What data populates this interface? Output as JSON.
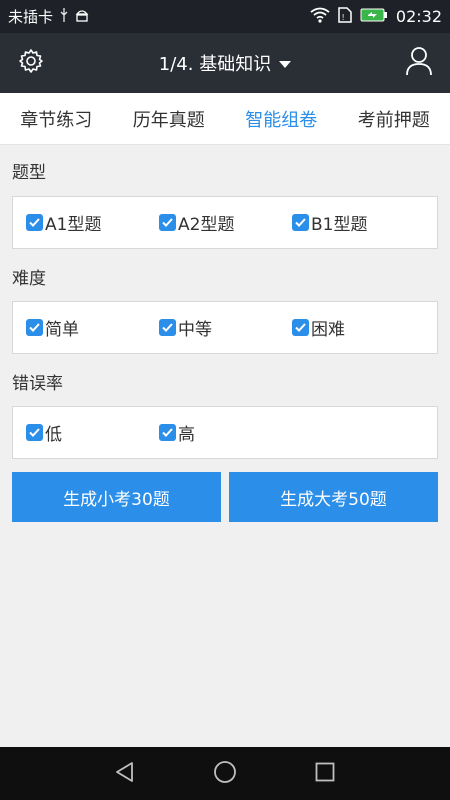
{
  "status_bar": {
    "carrier": "未插卡",
    "time": "02:32",
    "icons": [
      "usb-icon",
      "android-debug-icon",
      "wifi-icon",
      "sim-icon",
      "battery-icon"
    ]
  },
  "app_bar": {
    "title": "1/4. 基础知识",
    "dropdown_icon": "caret-down-icon",
    "left_icon": "gear-icon",
    "right_icon": "user-icon"
  },
  "tabs": [
    {
      "label": "章节练习",
      "active": false
    },
    {
      "label": "历年真题",
      "active": false
    },
    {
      "label": "智能组卷",
      "active": true
    },
    {
      "label": "考前押题",
      "active": false
    }
  ],
  "sections": {
    "question_type": {
      "label": "题型",
      "options": [
        {
          "label": "A1型题",
          "checked": true
        },
        {
          "label": "A2型题",
          "checked": true
        },
        {
          "label": "B1型题",
          "checked": true
        }
      ]
    },
    "difficulty": {
      "label": "难度",
      "options": [
        {
          "label": "简单",
          "checked": true
        },
        {
          "label": "中等",
          "checked": true
        },
        {
          "label": "困难",
          "checked": true
        }
      ]
    },
    "error_rate": {
      "label": "错误率",
      "options": [
        {
          "label": "低",
          "checked": true
        },
        {
          "label": "高",
          "checked": true
        }
      ]
    }
  },
  "buttons": {
    "small_exam": "生成小考30题",
    "big_exam": "生成大考50题"
  },
  "colors": {
    "accent": "#2b8ee8",
    "appbar": "#2a2e35",
    "statusbar": "#1e2127"
  }
}
